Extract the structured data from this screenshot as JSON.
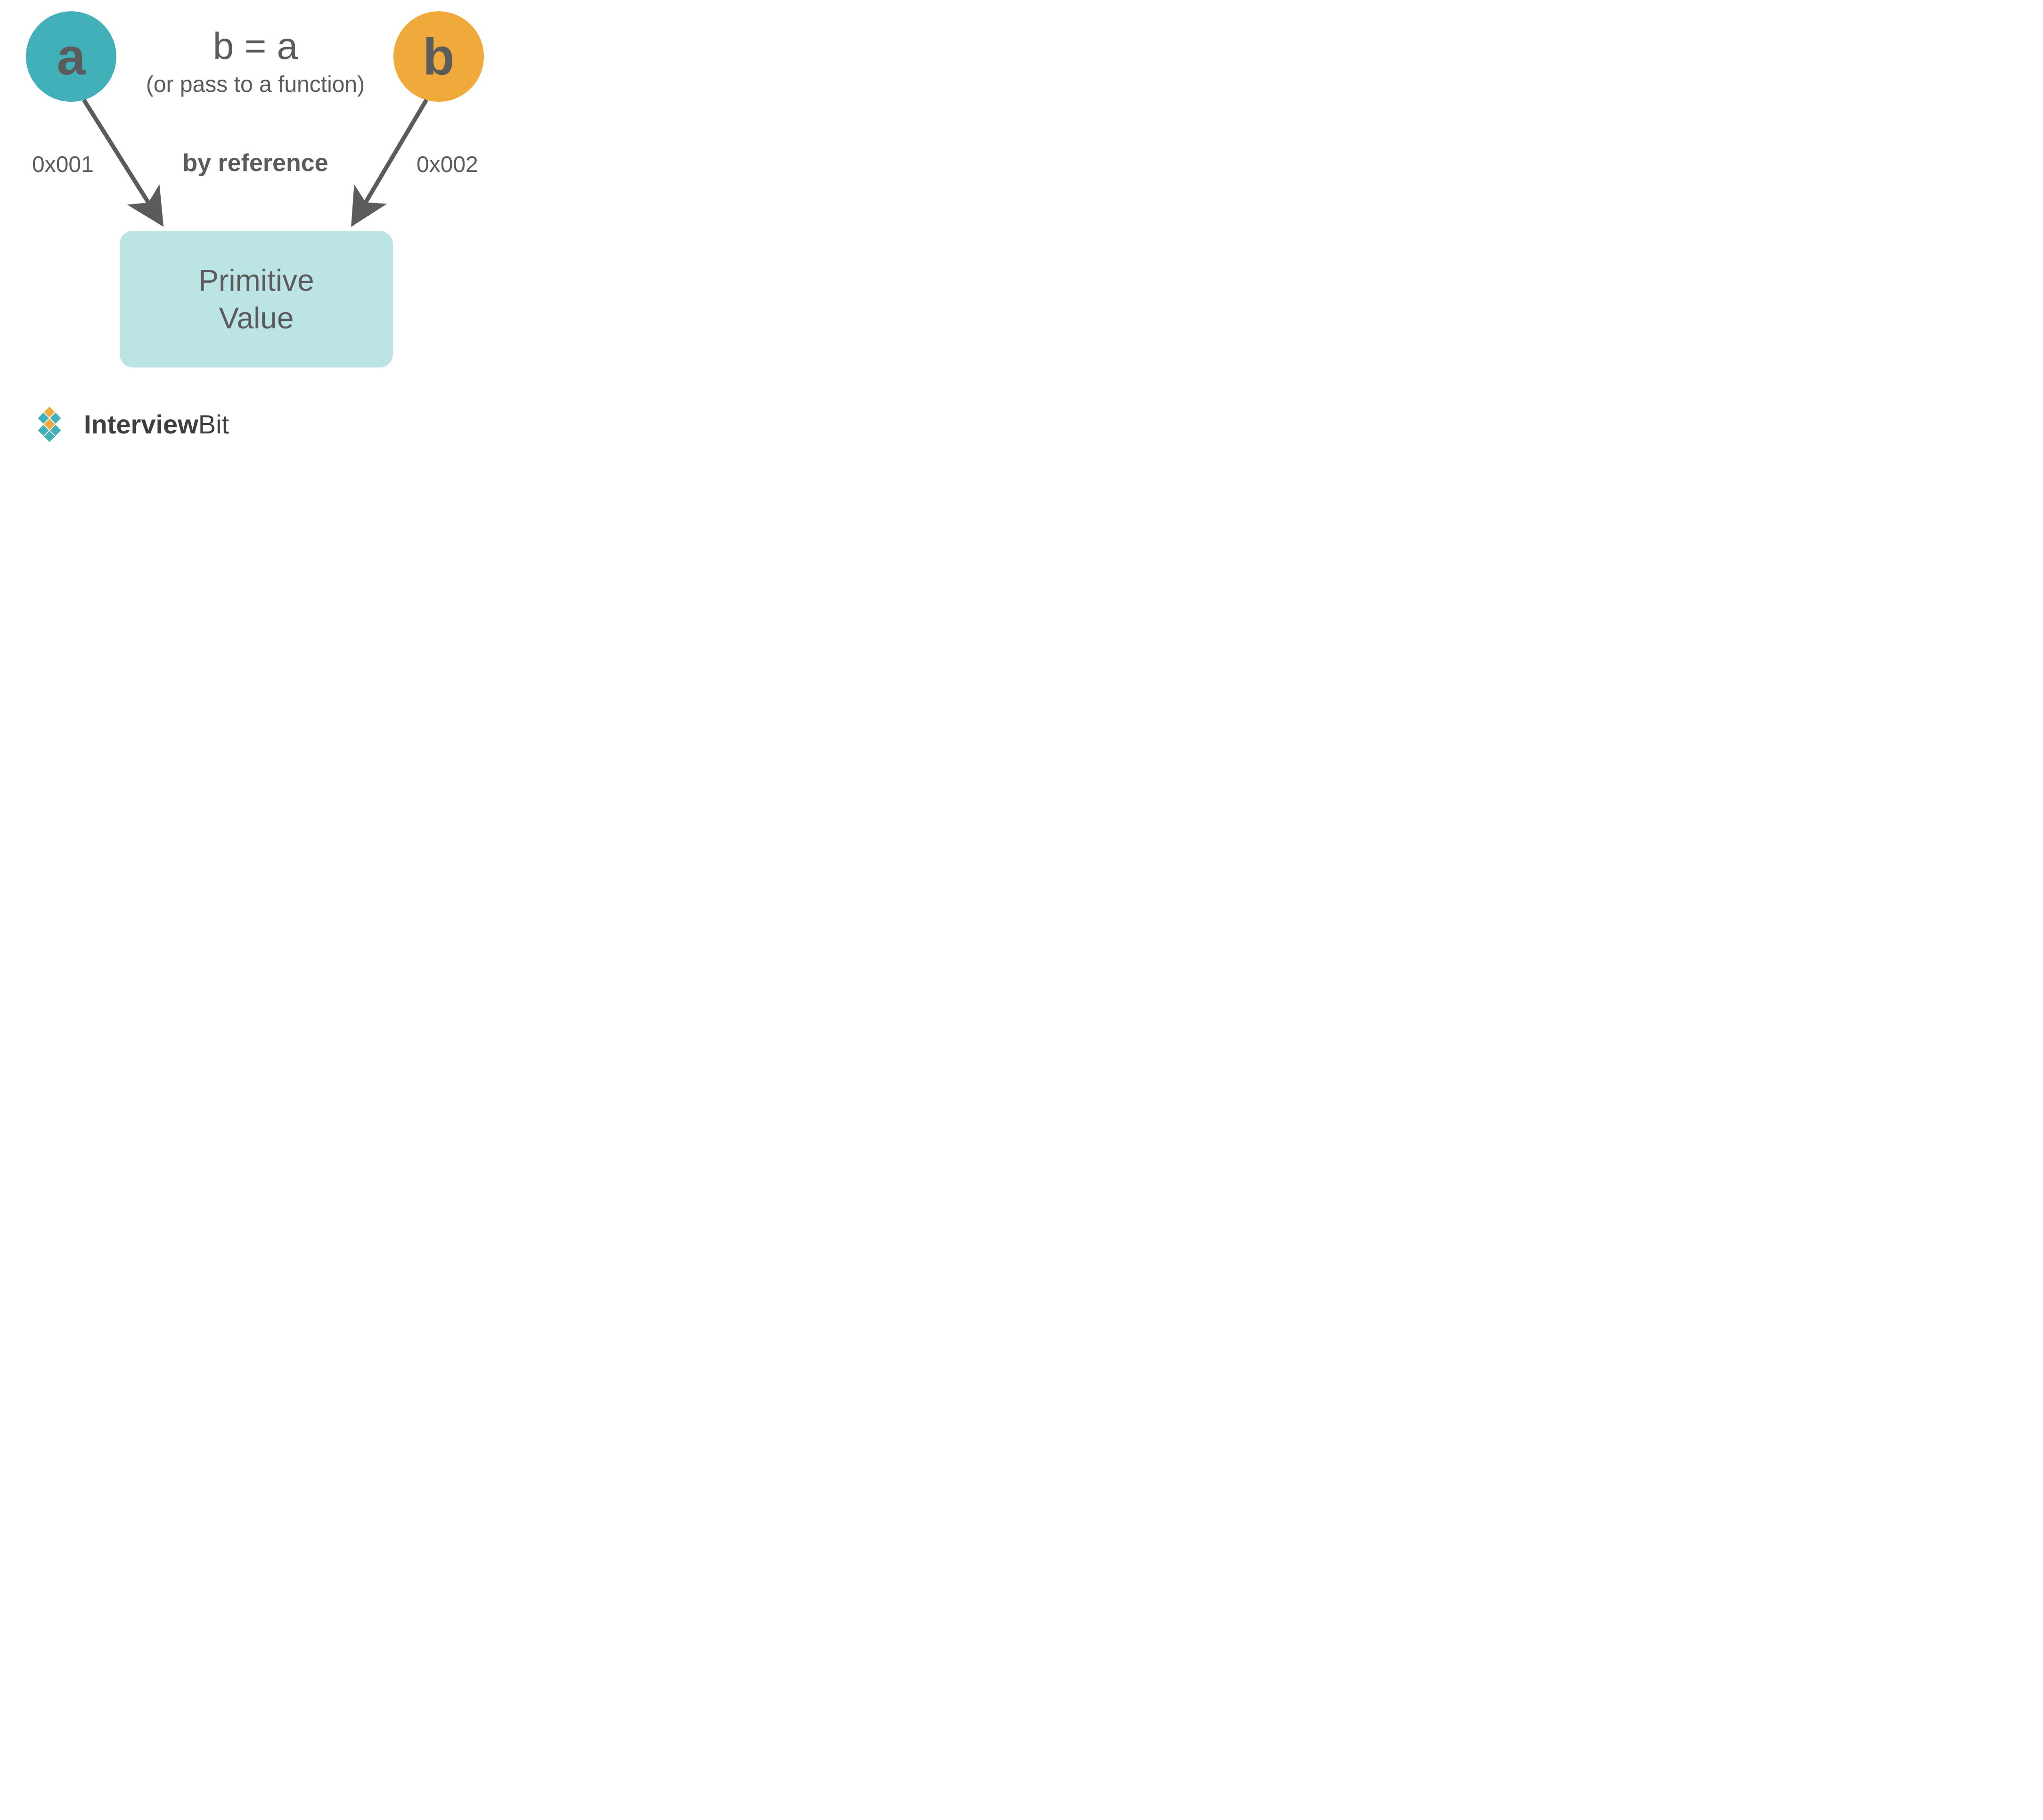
{
  "nodes": {
    "a_label": "a",
    "b_label": "b"
  },
  "center": {
    "assignment": "b = a",
    "assignment_note": "(or pass to a function)",
    "mode": "by reference"
  },
  "addresses": {
    "a": "0x001",
    "b": "0x002"
  },
  "box": {
    "line1": "Primitive",
    "line2": "Value"
  },
  "brand": {
    "name_bold": "Interview",
    "name_rest": "Bit"
  },
  "colors": {
    "teal": "#42b0b8",
    "teal_light": "#bde4e5",
    "orange": "#f0aa3c",
    "gray": "#5b5b5b"
  }
}
